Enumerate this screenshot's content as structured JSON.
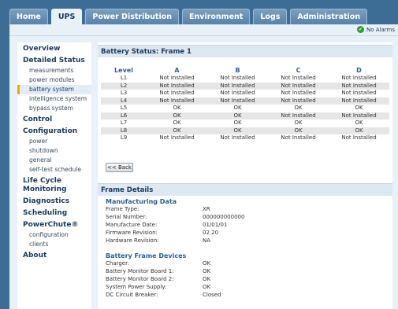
{
  "nav_tabs": [
    "Home",
    "UPS",
    "Power Distribution",
    "Environment",
    "Logs",
    "Administration"
  ],
  "alarm_status": "No Alarms",
  "sidebar": [
    {
      "label": "Overview",
      "type": "h"
    },
    {
      "label": "Detailed Status",
      "type": "h"
    },
    {
      "label": "measurements",
      "type": "s"
    },
    {
      "label": "power modules",
      "type": "s"
    },
    {
      "label": "battery system",
      "type": "s",
      "active": true
    },
    {
      "label": "intelligence system",
      "type": "s"
    },
    {
      "label": "bypass system",
      "type": "s"
    },
    {
      "label": "Control",
      "type": "h"
    },
    {
      "label": "Configuration",
      "type": "h"
    },
    {
      "label": "power",
      "type": "s"
    },
    {
      "label": "shutdown",
      "type": "s"
    },
    {
      "label": "general",
      "type": "s"
    },
    {
      "label": "self-test schedule",
      "type": "s"
    },
    {
      "label": "Life Cycle Monitoring",
      "type": "h2"
    },
    {
      "label": "Diagnostics",
      "type": "h"
    },
    {
      "label": "Scheduling",
      "type": "h"
    },
    {
      "label": "PowerChute®",
      "type": "h"
    },
    {
      "label": "configuration",
      "type": "s"
    },
    {
      "label": "clients",
      "type": "s"
    },
    {
      "label": "About",
      "type": "h"
    }
  ],
  "battery_status": {
    "title": "Battery Status: Frame 1",
    "columns": [
      "Level",
      "A",
      "B",
      "C",
      "D"
    ],
    "rows": [
      [
        "L1",
        "Not Installed",
        "Not Installed",
        "Not Installed",
        "Not Installed"
      ],
      [
        "L2",
        "Not Installed",
        "Not Installed",
        "Not Installed",
        "Not Installed"
      ],
      [
        "L3",
        "Not Installed",
        "Not Installed",
        "Not Installed",
        "Not Installed"
      ],
      [
        "L4",
        "Not Installed",
        "Not Installed",
        "Not Installed",
        "Not Installed"
      ],
      [
        "L5",
        "OK",
        "OK",
        "OK",
        "OK"
      ],
      [
        "L6",
        "OK",
        "OK",
        "Not Installed",
        "Not Installed"
      ],
      [
        "L7",
        "OK",
        "OK",
        "OK",
        "OK"
      ],
      [
        "L8",
        "OK",
        "OK",
        "OK",
        "OK"
      ],
      [
        "L9",
        "Not Installed",
        "Not Installed",
        "Not Installed",
        "Not Installed"
      ]
    ],
    "back_label": "<< Back"
  },
  "frame_details": {
    "title": "Frame Details",
    "manufacturing": {
      "heading": "Manufacturing Data",
      "fields": [
        {
          "label": "Frame Type:",
          "value": "XR"
        },
        {
          "label": "Serial Number:",
          "value": "000000000000"
        },
        {
          "label": "Manufacture Date:",
          "value": "01/01/01"
        },
        {
          "label": "Firmware Revision:",
          "value": "02.20"
        },
        {
          "label": "Hardware Revision:",
          "value": "NA"
        }
      ]
    },
    "devices": {
      "heading": "Battery Frame Devices",
      "fields": [
        {
          "label": "Charger:",
          "value": "OK"
        },
        {
          "label": "Battery Monitor Board 1:",
          "value": "OK"
        },
        {
          "label": "Battery Monitor Board 2:",
          "value": "OK"
        },
        {
          "label": "System Power Supply:",
          "value": "OK"
        },
        {
          "label": "DC Circuit Breaker:",
          "value": "Closed"
        }
      ]
    }
  }
}
